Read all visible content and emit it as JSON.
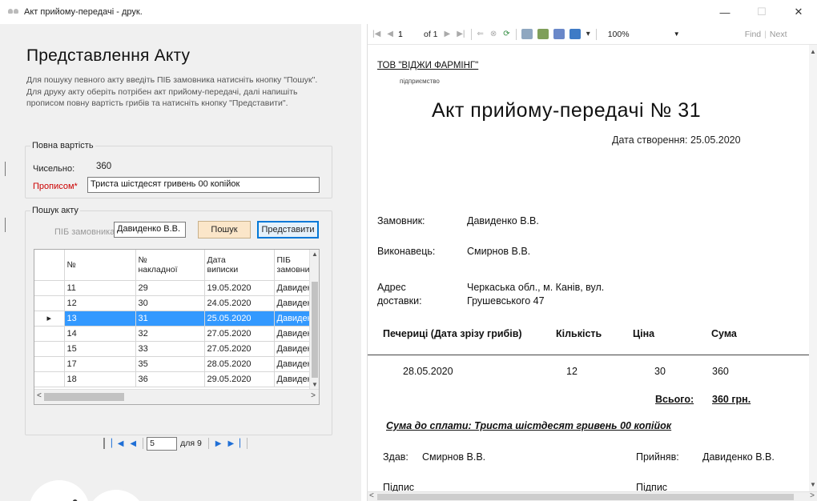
{
  "window": {
    "title": "Акт прийому-передачі - друк.",
    "minimize": "—",
    "maximize": "☐",
    "close": "✕"
  },
  "form": {
    "heading": "Представлення Акту",
    "description": "Для пошуку певного акту введіть ПІБ замовника натисніть кнопку \"Пошук\". Для друку акту оберіть потрібен акт прийому-передачі, далі напишіть прописом повну вартість грибів та натисніть кнопку \"Представити\".",
    "total_group": {
      "legend": "Повна вартість",
      "numeric_label": "Чисельно:",
      "numeric_value": "360",
      "words_label": "Прописом*",
      "words_value": "Триста шістдесят гривень 00 копійок"
    },
    "search_group": {
      "legend": "Пошук акту",
      "customer_label": "ПІБ замовника*:",
      "customer_value": "Давиденко В.В.",
      "search_button": "Пошук",
      "show_button": "Представити"
    },
    "grid": {
      "columns": [
        "№",
        "№ накладної",
        "Дата виписки",
        "ПІБ замовника"
      ],
      "col_lines": [
        [
          "№"
        ],
        [
          "№",
          "накладної"
        ],
        [
          "Дата",
          "виписки"
        ],
        [
          "ПІБ",
          "замовни"
        ]
      ],
      "rows": [
        [
          "11",
          "29",
          "19.05.2020",
          "Давиден"
        ],
        [
          "12",
          "30",
          "24.05.2020",
          "Давиден"
        ],
        [
          "13",
          "31",
          "25.05.2020",
          "Давиден"
        ],
        [
          "14",
          "32",
          "27.05.2020",
          "Давиден"
        ],
        [
          "15",
          "33",
          "27.05.2020",
          "Давиден"
        ],
        [
          "17",
          "35",
          "28.05.2020",
          "Давиден"
        ],
        [
          "18",
          "36",
          "29.05.2020",
          "Давиден"
        ]
      ],
      "selected_row": 2,
      "current_row_marker": "▸"
    },
    "pager": {
      "position": "5",
      "of_text": "для 9"
    }
  },
  "viewer": {
    "toolbar": {
      "page_value": "1",
      "of_pages": "of 1",
      "zoom": "100%",
      "find": "Find",
      "next": "Next"
    },
    "report": {
      "company": "ТОВ \"ВІДЖИ ФАРМІНГ\"",
      "enterprise_caption": "підприємство",
      "title": "Акт прийому-передачі № 31",
      "created_label": "Дата створення:",
      "created_value": "25.05.2020",
      "customer_label": "Замовник:",
      "customer_value": "Давиденко В.В.",
      "executor_label": "Виконавець:",
      "executor_value": "Смирнов В.В.",
      "address_label_1": "Адрес",
      "address_label_2": "доставки:",
      "address_value_1": "Черкаська обл., м. Канів, вул.",
      "address_value_2": "Грушевського 47",
      "table_headers": [
        "Печериці (Дата зрізу грибів)",
        "Кількість",
        "Ціна",
        "Сума"
      ],
      "table_row": [
        "28.05.2020",
        "12",
        "30",
        "360"
      ],
      "total_label": "Всього:",
      "total_value": "360 грн.",
      "to_pay": "Сума до сплати: Триста шістдесят гривень 00 копійок",
      "handed_label": "Здав:",
      "handed_value": "Смирнов В.В.",
      "received_label": "Прийняв:",
      "received_value": "Давиденко В.В.",
      "sign_label": "Підпис"
    }
  },
  "colors": {
    "selection": "#3399ff",
    "search_button": "#fbe6c9",
    "show_button_border": "#0078d7",
    "required_label": "#cc0000"
  }
}
